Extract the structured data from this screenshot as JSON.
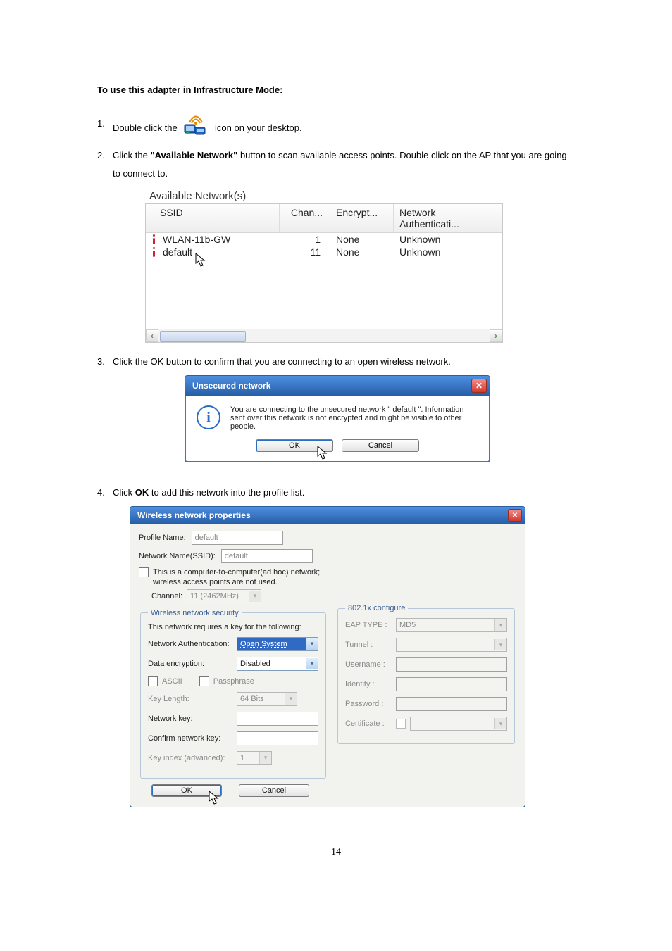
{
  "doc": {
    "heading": "To use this adapter in Infrastructure Mode:",
    "step1_a": "Double click the ",
    "step1_b": " icon on your desktop.",
    "step2_a": "Click the ",
    "step2_bold": "\"Available Network\"",
    "step2_b": " button to scan available access points. Double click on the AP that you are going to connect to.",
    "step3": "Click the OK button to confirm that you are connecting to an open wireless network.",
    "step4_a": "Click ",
    "step4_bold": "OK",
    "step4_b": " to add this network into the profile list.",
    "page_number": "14"
  },
  "fig1": {
    "title": "Available Network(s)",
    "headers": {
      "ssid": "SSID",
      "chan": "Chan...",
      "enc": "Encrypt...",
      "auth": "Network Authenticati..."
    },
    "rows": [
      {
        "ssid": "WLAN-11b-GW",
        "chan": "1",
        "enc": "None",
        "auth": "Unknown"
      },
      {
        "ssid": "default",
        "chan": "11",
        "enc": "None",
        "auth": "Unknown"
      }
    ]
  },
  "fig2": {
    "title": "Unsecured network",
    "body": "You are connecting to the unsecured network \" default \". Information sent over this network is not encrypted and might be visible to other people.",
    "ok": "OK",
    "cancel": "Cancel"
  },
  "fig3": {
    "title": "Wireless network properties",
    "profile_name_label": "Profile Name:",
    "profile_name_value": "default",
    "ssid_label": "Network Name(SSID):",
    "ssid_value": "default",
    "adhoc_text": "This is a computer-to-computer(ad hoc) network; wireless access points are not used.",
    "channel_label": "Channel:",
    "channel_value": "11 (2462MHz)",
    "sec_legend": "Wireless network security",
    "sec_text": "This network requires a key for the following:",
    "net_auth_label": "Network Authentication:",
    "net_auth_value": "Open System",
    "data_enc_label": "Data encryption:",
    "data_enc_value": "Disabled",
    "ascii": "ASCII",
    "passphrase": "Passphrase",
    "keylen_label": "Key Length:",
    "keylen_value": "64 Bits",
    "netkey_label": "Network key:",
    "confirm_label": "Confirm network key:",
    "keyidx_label": "Key index (advanced):",
    "keyidx_value": "1",
    "conf_legend": "802.1x configure",
    "eap_label": "EAP TYPE :",
    "eap_value": "MD5",
    "tunnel_label": "Tunnel :",
    "username_label": "Username :",
    "identity_label": "Identity :",
    "password_label": "Password :",
    "cert_label": "Certificate :",
    "ok": "OK",
    "cancel": "Cancel"
  }
}
